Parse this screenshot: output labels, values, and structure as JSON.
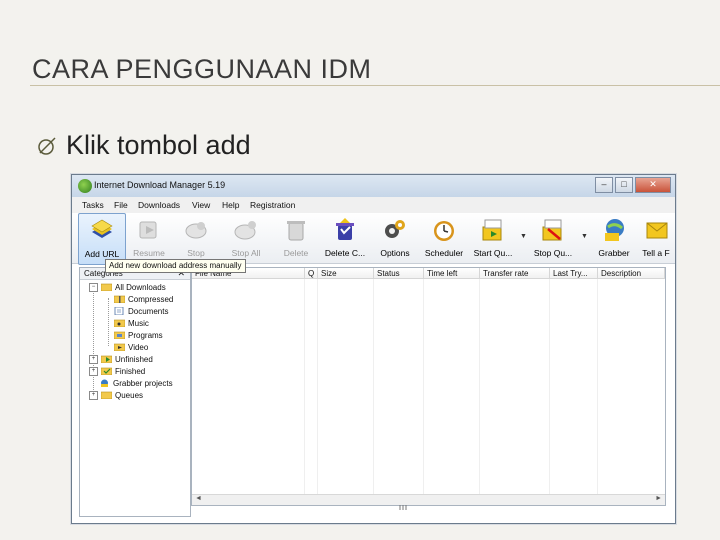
{
  "slide": {
    "title": "CARA PENGGUNAAN IDM",
    "bullet_text": "Klik tombol add"
  },
  "window": {
    "title": "Internet Download Manager 5.19",
    "controls": [
      "–",
      "□",
      "✕"
    ]
  },
  "menu": [
    "Tasks",
    "File",
    "Downloads",
    "View",
    "Help",
    "Registration"
  ],
  "toolbar": {
    "buttons": [
      {
        "label": "Add URL",
        "icon": "add-url-icon",
        "enabled": true,
        "active": true
      },
      {
        "label": "Resume",
        "icon": "resume-icon",
        "enabled": false
      },
      {
        "label": "Stop",
        "icon": "stop-icon",
        "enabled": false
      },
      {
        "label": "Stop All",
        "icon": "stop-all-icon",
        "enabled": false
      },
      {
        "label": "Delete",
        "icon": "delete-icon",
        "enabled": false
      },
      {
        "label": "Delete C...",
        "icon": "delete-completed-icon",
        "enabled": true
      },
      {
        "label": "Options",
        "icon": "options-icon",
        "enabled": true
      },
      {
        "label": "Scheduler",
        "icon": "scheduler-icon",
        "enabled": true
      },
      {
        "label": "Start Qu...",
        "icon": "start-queue-icon",
        "enabled": true
      },
      {
        "label": "Stop Qu...",
        "icon": "stop-queue-icon",
        "enabled": true
      },
      {
        "label": "Grabber",
        "icon": "grabber-icon",
        "enabled": true
      },
      {
        "label": "Tell a F",
        "icon": "tell-friend-icon",
        "enabled": true
      }
    ],
    "tooltip": "Add new download address manually"
  },
  "categories": {
    "title": "Categories",
    "close": "✕",
    "items": [
      {
        "label": "All Downloads",
        "level": 0,
        "expander": "−"
      },
      {
        "label": "Compressed",
        "level": 1
      },
      {
        "label": "Documents",
        "level": 1
      },
      {
        "label": "Music",
        "level": 1
      },
      {
        "label": "Programs",
        "level": 1
      },
      {
        "label": "Video",
        "level": 1
      },
      {
        "label": "Unfinished",
        "level": 0,
        "expander": "+"
      },
      {
        "label": "Finished",
        "level": 0,
        "expander": "+"
      },
      {
        "label": "Grabber projects",
        "level": 0
      },
      {
        "label": "Queues",
        "level": 0,
        "expander": "+"
      }
    ]
  },
  "list": {
    "columns": [
      "File Name",
      "Q",
      "Size",
      "Status",
      "Time left",
      "Transfer rate",
      "Last Try...",
      "Description"
    ]
  },
  "scroll": {
    "left": "◄",
    "right": "►",
    "thumb": "III"
  },
  "colors": {
    "accent": "#7da2ce",
    "title_rule": "#c9c1a6"
  }
}
